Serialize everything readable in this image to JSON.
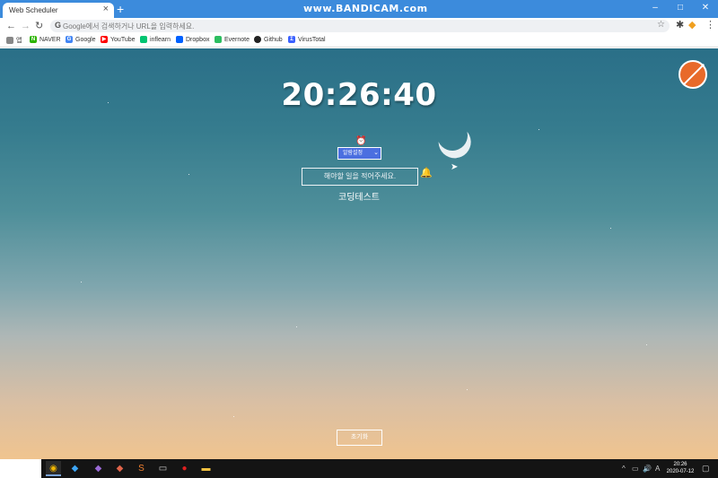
{
  "browser": {
    "tab_title": "Web Scheduler",
    "tab_close": "×",
    "new_tab": "+",
    "watermark": "www.BANDICAM.com",
    "window_controls": {
      "minimize": "–",
      "maximize": "□",
      "close": "✕"
    },
    "nav": {
      "back": "←",
      "forward": "→",
      "reload": "↻"
    },
    "omnibox_g": "G",
    "omnibox_placeholder": "Google에서 검색하거나 URL을 입력하세요.",
    "star": "☆",
    "bookmarks": [
      {
        "label": "앱",
        "icon": "apps-grid-icon",
        "color": "#888888"
      },
      {
        "label": "NAVER",
        "icon": "naver-icon",
        "color": "#2db400"
      },
      {
        "label": "Google",
        "icon": "google-icon",
        "color": "#4285f4"
      },
      {
        "label": "YouTube",
        "icon": "youtube-icon",
        "color": "#ff0000"
      },
      {
        "label": "inflearn",
        "icon": "inflearn-icon",
        "color": "#00c471"
      },
      {
        "label": "Dropbox",
        "icon": "dropbox-icon",
        "color": "#0061ff"
      },
      {
        "label": "Evernote",
        "icon": "evernote-icon",
        "color": "#2dbe60"
      },
      {
        "label": "Github",
        "icon": "github-icon",
        "color": "#222222"
      },
      {
        "label": "VirusTotal",
        "icon": "virustotal-icon",
        "color": "#3b61ff"
      }
    ]
  },
  "app": {
    "clock": "20:26:40",
    "alarm_select_value": "알람설정",
    "alarm_select_caret": "⌄",
    "todo_placeholder": "해야할 일을 적어주세요.",
    "todo_items": [
      "코딩테스트"
    ],
    "reset_button": "초기화"
  },
  "taskbar": {
    "time": "20:26",
    "date": "2020-07-12",
    "tray_chevron": "^",
    "volume_icon": "🔊"
  }
}
